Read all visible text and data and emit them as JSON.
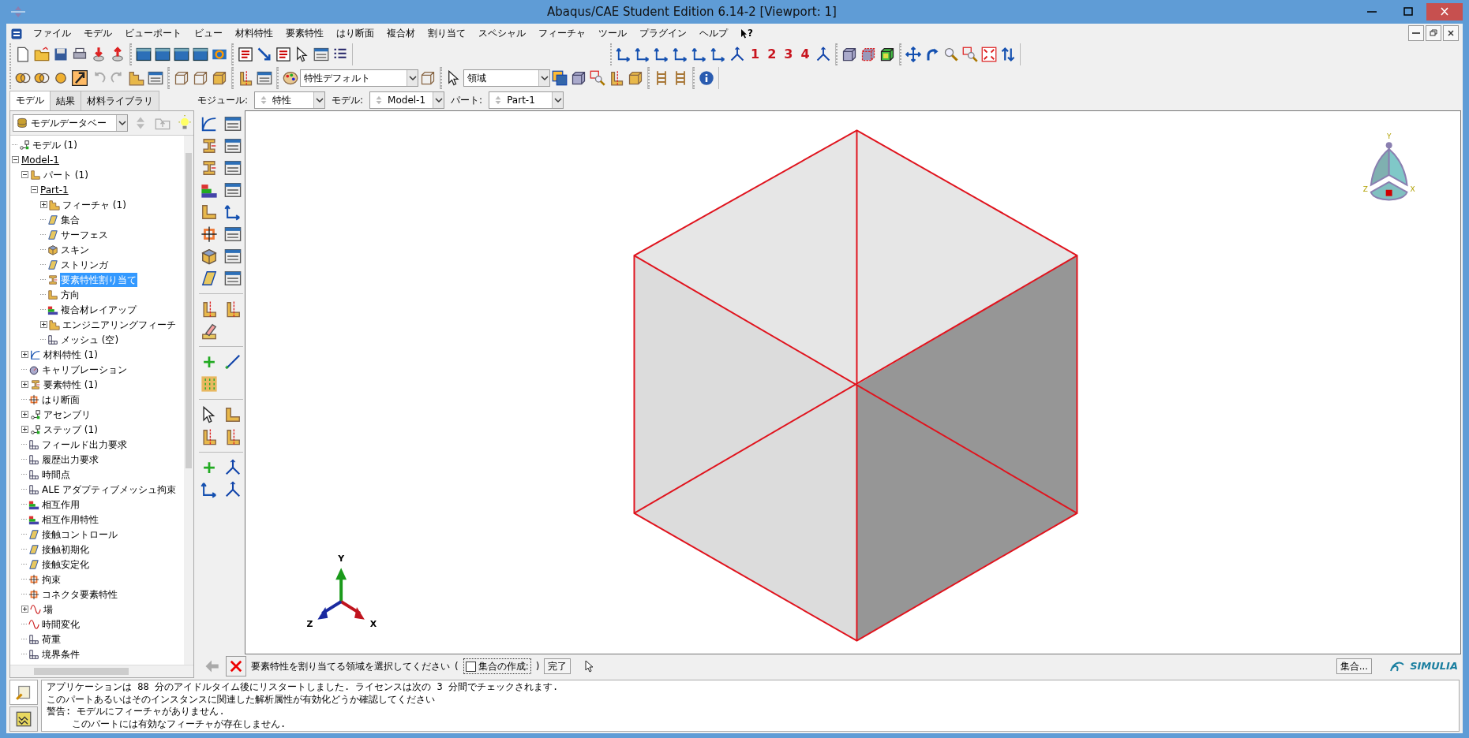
{
  "window": {
    "title": "Abaqus/CAE Student Edition 6.14-2 [Viewport: 1]"
  },
  "menu": {
    "items": [
      "ファイル",
      "モデル",
      "ビューポート",
      "ビュー",
      "材料特性",
      "要素特性",
      "はり断面",
      "複合材",
      "割り当て",
      "スペシャル",
      "フィーチャ",
      "ツール",
      "プラグイン",
      "ヘルプ"
    ],
    "context_help": "?"
  },
  "toolbar": {
    "view_buttons": [
      "1",
      "2",
      "3",
      "4"
    ],
    "style_combo": "特性デフォルト",
    "selection_combo": "領域"
  },
  "tabs": [
    {
      "label": "モデル",
      "selected": true
    },
    {
      "label": "結果",
      "selected": false
    },
    {
      "label": "材料ライブラリ",
      "selected": false
    }
  ],
  "context_bar": [
    {
      "label": "モジュール:",
      "value": "特性"
    },
    {
      "label": "モデル:",
      "value": "Model-1"
    },
    {
      "label": "パート:",
      "value": "Part-1"
    }
  ],
  "tree_combo": "モデルデータベー",
  "tree": [
    {
      "label": "モデル (1)",
      "selected": false,
      "current": false
    },
    {
      "label": "Model-1",
      "selected": false,
      "current": true,
      "expanded": true,
      "children": [
        {
          "label": "パート (1)",
          "selected": false,
          "current": false,
          "expanded": true,
          "children": [
            {
              "label": "Part-1",
              "selected": false,
              "current": true,
              "expanded": true,
              "children": [
                {
                  "label": "フィーチャ (1)",
                  "selected": false,
                  "current": false,
                  "expanded": false
                },
                {
                  "label": "集合",
                  "selected": false,
                  "current": false
                },
                {
                  "label": "サーフェス",
                  "selected": false,
                  "current": false
                },
                {
                  "label": "スキン",
                  "selected": false,
                  "current": false
                },
                {
                  "label": "ストリンガ",
                  "selected": false,
                  "current": false
                },
                {
                  "label": "要素特性割り当て",
                  "selected": true,
                  "current": false
                },
                {
                  "label": "方向",
                  "selected": false,
                  "current": false
                },
                {
                  "label": "複合材レイアップ",
                  "selected": false,
                  "current": false
                },
                {
                  "label": "エンジニアリングフィーチ",
                  "selected": false,
                  "current": false,
                  "expanded": false
                },
                {
                  "label": "メッシュ (空)",
                  "selected": false,
                  "current": false
                }
              ]
            }
          ]
        },
        {
          "label": "材料特性 (1)",
          "selected": false,
          "current": false,
          "expanded": false
        },
        {
          "label": "キャリブレーション",
          "selected": false,
          "current": false
        },
        {
          "label": "要素特性 (1)",
          "selected": false,
          "current": false,
          "expanded": false
        },
        {
          "label": "はり断面",
          "selected": false,
          "current": false
        },
        {
          "label": "アセンブリ",
          "selected": false,
          "current": false,
          "expanded": false
        },
        {
          "label": "ステップ (1)",
          "selected": false,
          "current": false,
          "expanded": false
        },
        {
          "label": "フィールド出力要求",
          "selected": false,
          "current": false
        },
        {
          "label": "履歴出力要求",
          "selected": false,
          "current": false
        },
        {
          "label": "時間点",
          "selected": false,
          "current": false
        },
        {
          "label": "ALE アダプティブメッシュ拘束",
          "selected": false,
          "current": false
        },
        {
          "label": "相互作用",
          "selected": false,
          "current": false
        },
        {
          "label": "相互作用特性",
          "selected": false,
          "current": false
        },
        {
          "label": "接触コントロール",
          "selected": false,
          "current": false
        },
        {
          "label": "接触初期化",
          "selected": false,
          "current": false
        },
        {
          "label": "接触安定化",
          "selected": false,
          "current": false
        },
        {
          "label": "拘束",
          "selected": false,
          "current": false
        },
        {
          "label": "コネクタ要素特性",
          "selected": false,
          "current": false
        },
        {
          "label": "場",
          "selected": false,
          "current": false,
          "expanded": false
        },
        {
          "label": "時間変化",
          "selected": false,
          "current": false
        },
        {
          "label": "荷重",
          "selected": false,
          "current": false
        },
        {
          "label": "境界条件",
          "selected": false,
          "current": false
        }
      ]
    }
  ],
  "viewport": {
    "triad": {
      "x": "X",
      "y": "Y",
      "z": "Z"
    },
    "compass": {
      "y": "Y",
      "z": "Z",
      "x": "X"
    }
  },
  "prompt": {
    "text": "要素特性を割り当てる領域を選択してください",
    "open_paren": "(",
    "checkbox": {
      "label": "集合の作成:",
      "checked": false
    },
    "close_paren": ")",
    "done": "完了",
    "sets_button": "集合...",
    "logo": "SIMULIA"
  },
  "messages": [
    {
      "text": "アプリケーションは 88 分のアイドルタイム後にリスタートしました. ライセンスは次の 3 分間でチェックされます.",
      "indented": false
    },
    {
      "text": "このパートあるいはそのインスタンスに関連した解析属性が有効化どうか確認してください",
      "indented": false
    },
    {
      "text": "警告: モデルにフィーチャがありません.",
      "indented": false
    },
    {
      "text": "このパートには有効なフィーチャが存在しません.",
      "indented": true
    }
  ]
}
